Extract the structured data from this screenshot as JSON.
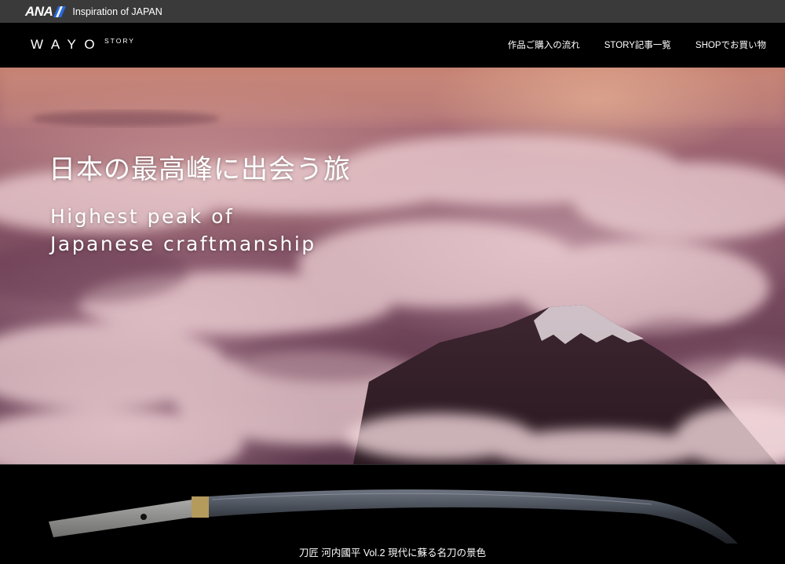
{
  "ana_bar": {
    "logo_text": "ANA",
    "tagline": "Inspiration of JAPAN"
  },
  "header": {
    "brand": "WAYO",
    "brand_sub": "STORY",
    "nav": [
      {
        "label": "作品ご購入の流れ"
      },
      {
        "label": "STORY記事一覧"
      },
      {
        "label": "SHOPでお買い物"
      }
    ]
  },
  "hero": {
    "title_jp": "日本の最高峰に出会う旅",
    "title_en_line1": "Highest peak of",
    "title_en_line2": "Japanese craftmanship"
  },
  "feature": {
    "caption": "刀匠 河内國平 Vol.2 現代に蘇る名刀の景色"
  },
  "colors": {
    "ana_bar_bg": "#3a3a3a",
    "header_bg": "#000000",
    "ana_blue": "#2a6ad8"
  }
}
